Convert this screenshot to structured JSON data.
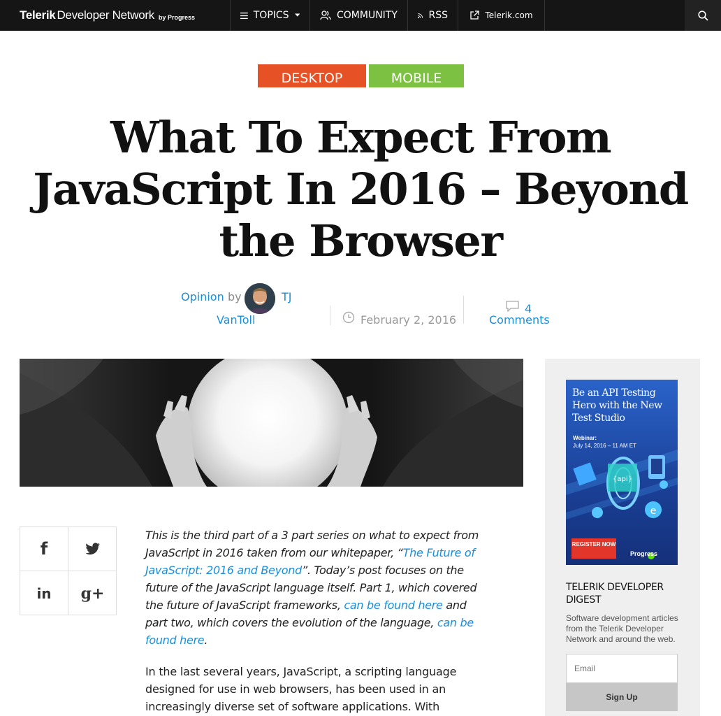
{
  "nav": {
    "brand_bold": "Telerik",
    "brand_rest": "Developer Network",
    "brand_by": "by",
    "brand_progress": "Progress",
    "topics": "TOPICS",
    "community": "COMMUNITY",
    "rss": "RSS",
    "telerik_link": "Telerik.com"
  },
  "categories": {
    "desktop": "DESKTOP",
    "mobile": "MOBILE"
  },
  "article": {
    "title": "What To Expect From JavaScript In 2016 – Beyond the Browser",
    "category": "Opinion",
    "by": "by",
    "author_first": "TJ",
    "author_last": "VanToll",
    "date": "February 2, 2016",
    "comment_count": "4",
    "comments_label": "Comments",
    "intro_1": "This is the third part of a 3 part series on what to expect from JavaScript in 2016 taken from our whitepaper, “",
    "intro_link_1": "The Future of JavaScript: 2016 and Beyond",
    "intro_2": "”. Today’s post focuses on the future of the JavaScript language itself. Part 1, which covered the future of JavaScript frameworks, ",
    "intro_link_2": "can be found here",
    "intro_3": " and part two, which covers the evolution of the language, ",
    "intro_link_3": "can be found here",
    "intro_4": ".",
    "para_2": "In the last several years, JavaScript, a scripting language designed for use in web browsers, has been used in an increasingly diverse set of software applications. With"
  },
  "share": {
    "facebook": "f",
    "linkedin": "in",
    "googleplus": "g+"
  },
  "ad": {
    "headline": "Be an API Testing Hero with the New Test Studio",
    "webinar_label": "Webinar:",
    "webinar_date": "July 14, 2016 – 11 AM ET",
    "register": "REGISTER NOW",
    "sponsor": "Progress"
  },
  "sidebar": {
    "digest_title": "TELERIK DEVELOPER DIGEST",
    "digest_desc": "Software development articles from the Telerik Developer Network and around the web.",
    "email_placeholder": "Email",
    "signup_label": "Sign Up"
  },
  "colors": {
    "nav_bg": "#151515",
    "desktop_tab": "#e65125",
    "mobile_tab": "#7dc142",
    "link": "#1a8fd9",
    "sidebar_bg": "#efefef"
  }
}
